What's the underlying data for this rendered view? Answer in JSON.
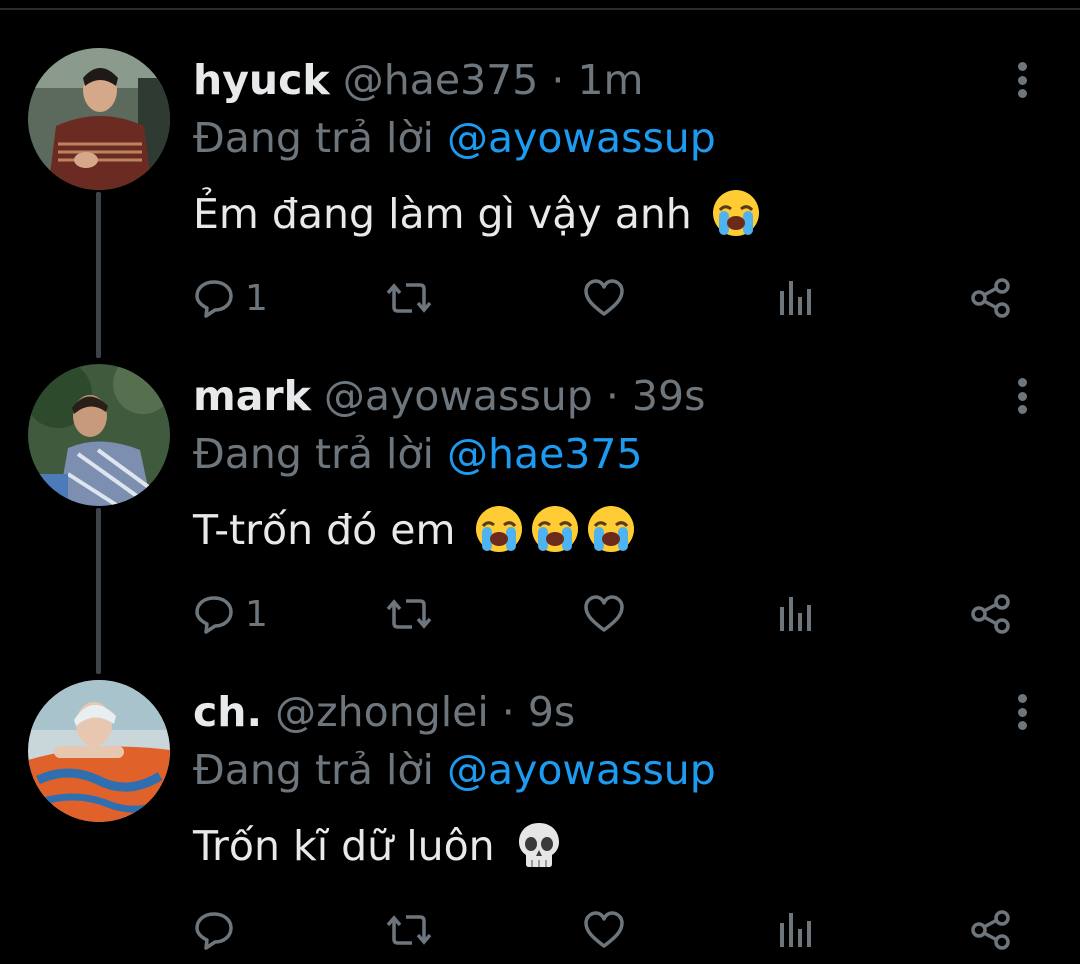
{
  "tweets": [
    {
      "name": "hyuck",
      "handle": "@hae375",
      "time": "· 1m",
      "reply_prefix": "Đang trả lời",
      "reply_to": "@ayowassup",
      "text": "Ẻm đang làm gì vậy anh",
      "emojis": [
        "loudly-crying-face"
      ],
      "reply_count": "1",
      "avatar_colors": {
        "bg": "#5b6a5d",
        "shirt": "#6b2b22",
        "skin": "#d6a88a"
      }
    },
    {
      "name": "mark",
      "handle": "@ayowassup",
      "time": "· 39s",
      "reply_prefix": "Đang trả lời",
      "reply_to": "@hae375",
      "text": "T-trốn đó em",
      "emojis": [
        "loudly-crying-face",
        "loudly-crying-face",
        "loudly-crying-face"
      ],
      "reply_count": "1",
      "avatar_colors": {
        "bg": "#3f5a3c",
        "shirt": "#7d8fb0",
        "skin": "#c79a7c"
      }
    },
    {
      "name": "ch.",
      "handle": "@zhonglei",
      "time": "· 9s",
      "reply_prefix": "Đang trả lời",
      "reply_to": "@ayowassup",
      "text": "Trốn kĩ dữ luôn",
      "emojis": [
        "skull"
      ],
      "reply_count": "",
      "avatar_colors": {
        "bg": "#c9d6da",
        "shirt": "#e0612a",
        "skin": "#e8c7b0"
      }
    }
  ],
  "icons": {
    "reply": "comment-bubble-icon",
    "retweet": "retweet-icon",
    "like": "heart-icon",
    "analytics": "analytics-bars-icon",
    "share": "share-icon",
    "more": "more-vertical-icon"
  },
  "colors": {
    "background": "#000000",
    "name": "#e7e9ea",
    "meta": "#6e767d",
    "link": "#1d9bf0",
    "thread_line": "#3d4349"
  }
}
